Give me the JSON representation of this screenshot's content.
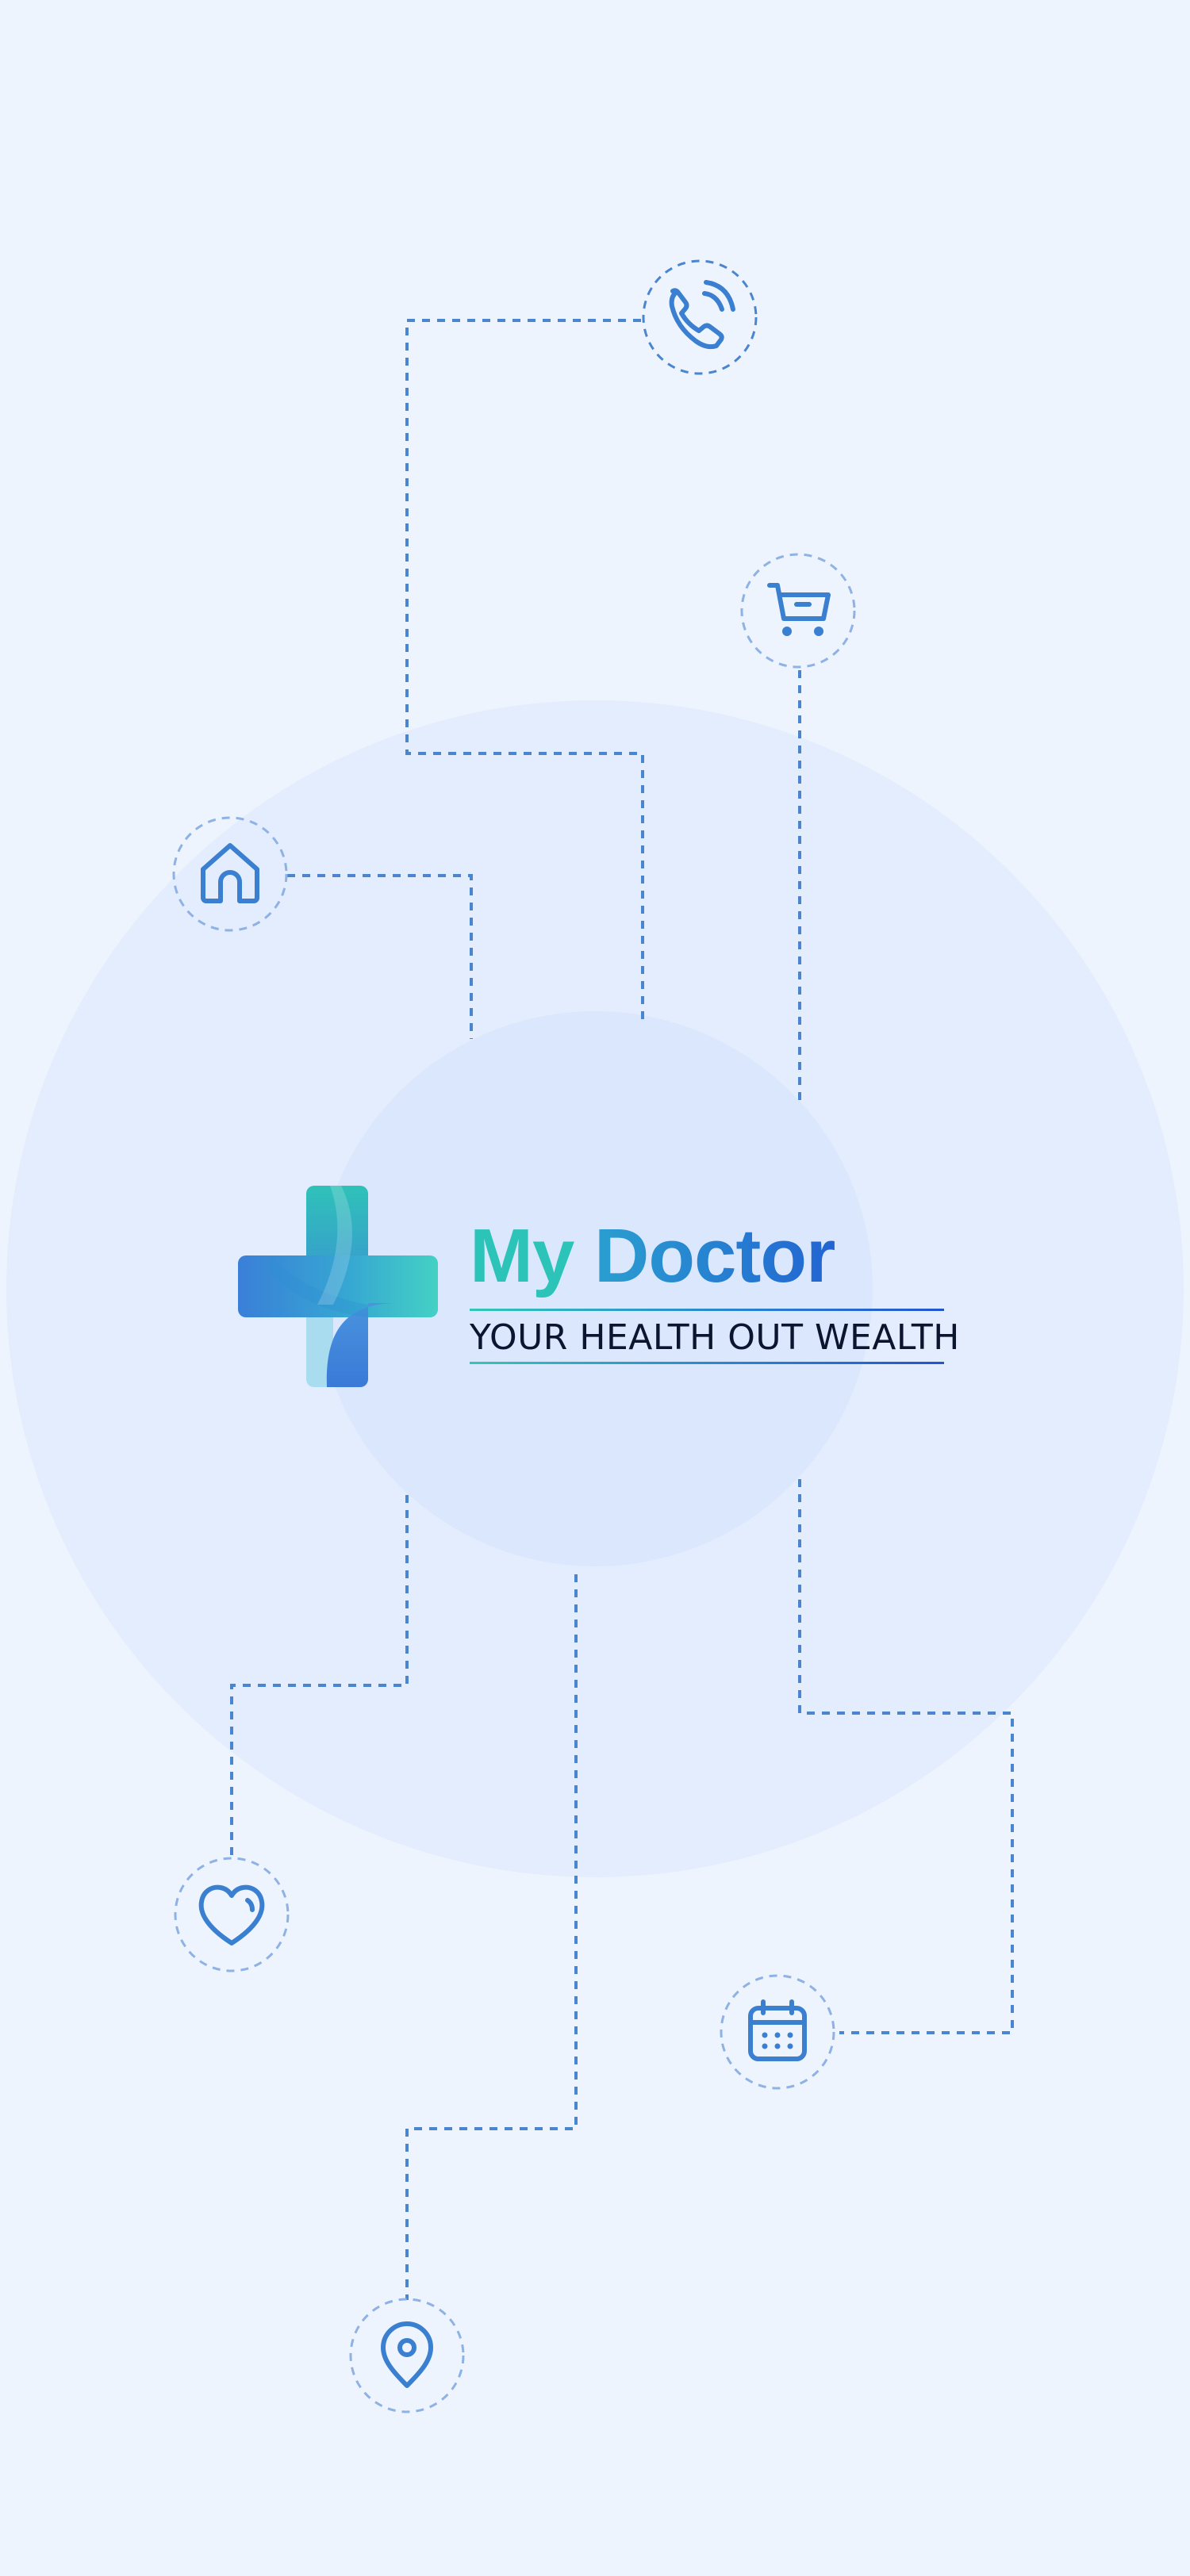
{
  "brand": {
    "name_part1": "My",
    "name_part2": "Doctor",
    "tagline": "YOUR HEALTH OUT WEALTH"
  },
  "colors": {
    "background": "#eef4fe",
    "outer_circle": "#e3edfd",
    "inner_circle": "#dbe7fd",
    "connector": "#4a86cf",
    "icon": "#3a7fd0",
    "brand_teal": "#2cc3b8",
    "brand_blue": "#2264d2"
  },
  "icons": [
    {
      "name": "phone-icon",
      "label": "phone"
    },
    {
      "name": "cart-icon",
      "label": "cart"
    },
    {
      "name": "home-icon",
      "label": "home"
    },
    {
      "name": "heart-icon",
      "label": "heart"
    },
    {
      "name": "calendar-icon",
      "label": "calendar"
    },
    {
      "name": "location-pin-icon",
      "label": "location"
    }
  ]
}
